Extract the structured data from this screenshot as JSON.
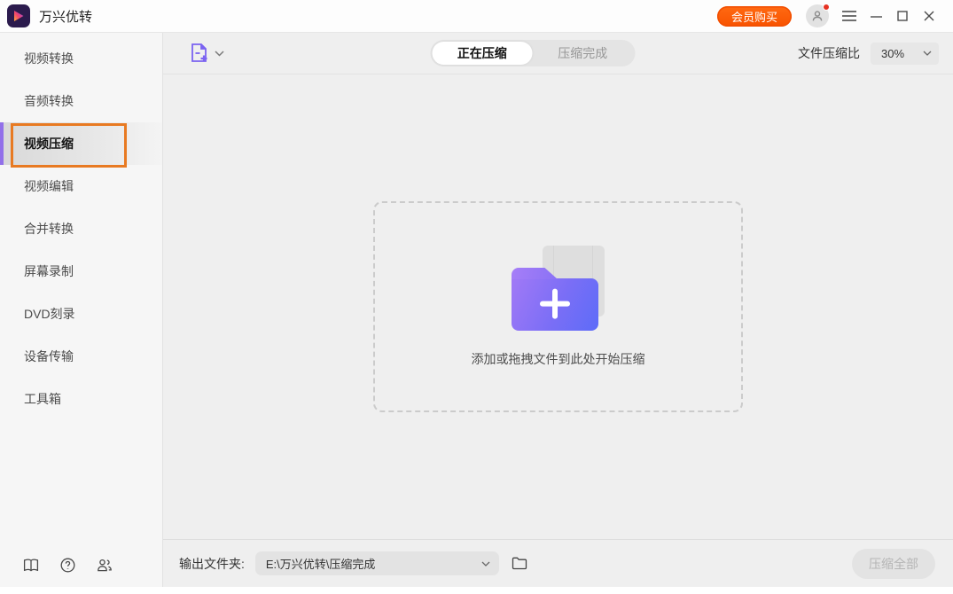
{
  "titlebar": {
    "app_title": "万兴优转",
    "buy_button_label": "会员购买"
  },
  "sidebar": {
    "items": [
      {
        "label": "视频转换",
        "selected": false
      },
      {
        "label": "音频转换",
        "selected": false
      },
      {
        "label": "视频压缩",
        "selected": true
      },
      {
        "label": "视频编辑",
        "selected": false
      },
      {
        "label": "合并转换",
        "selected": false
      },
      {
        "label": "屏幕录制",
        "selected": false
      },
      {
        "label": "DVD刻录",
        "selected": false
      },
      {
        "label": "设备传输",
        "selected": false
      },
      {
        "label": "工具箱",
        "selected": false
      }
    ],
    "footer_icons": [
      "user-guide-book-icon",
      "help-question-icon",
      "community-icon"
    ]
  },
  "toolbar": {
    "add_file_icon": "add-file-icon",
    "tabs": [
      {
        "label": "正在压缩",
        "active": true
      },
      {
        "label": "压缩完成",
        "active": false
      }
    ],
    "compression_ratio_label": "文件压缩比",
    "compression_ratio_value": "30%"
  },
  "dropzone": {
    "hint": "添加或拖拽文件到此处开始压缩",
    "illustration": "add-folder-icon"
  },
  "bottombar": {
    "output_folder_label": "输出文件夹:",
    "output_folder_path": "E:\\万兴优转\\压缩完成",
    "compress_all_label": "压缩全部",
    "compress_all_enabled": false
  },
  "colors": {
    "accent_orange": "#e87a22",
    "buy_button_orange": "#f85200",
    "accent_purple": "#7b63f1",
    "active_bar_purple": "#9270e9",
    "folder_gradient_start": "#a179f6",
    "folder_gradient_end": "#5d6cf8",
    "main_bg": "#efefef",
    "sidebar_bg": "#f6f6f6",
    "disabled_text": "#b5b5b5",
    "notification_red": "#e63222"
  }
}
